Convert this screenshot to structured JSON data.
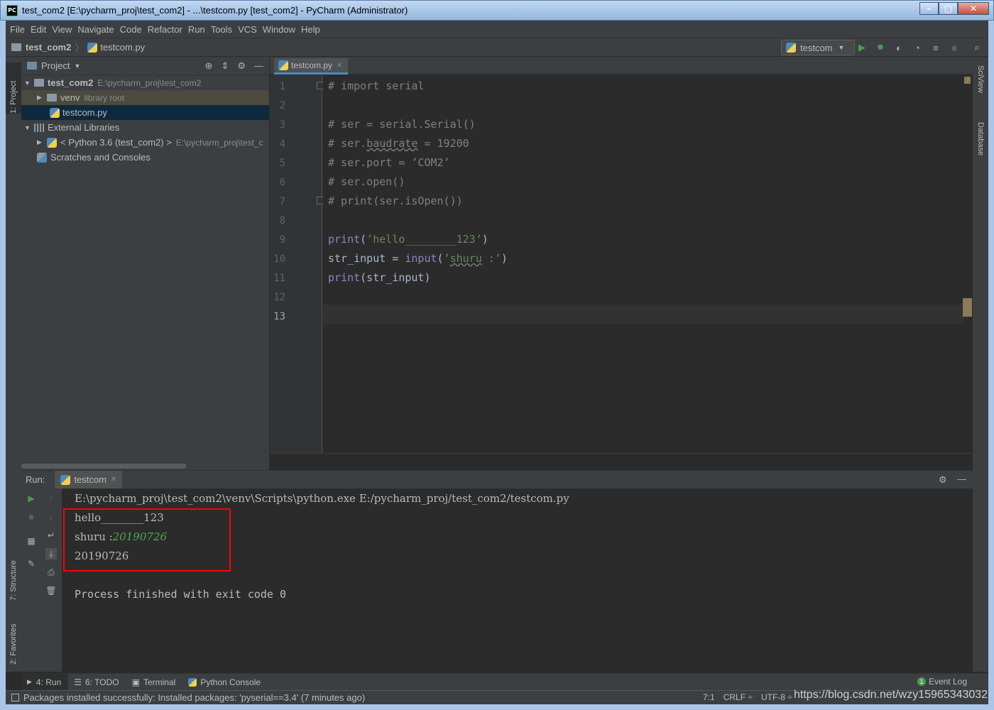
{
  "window": {
    "app_icon": "PC",
    "title": "test_com2 [E:\\pycharm_proj\\test_com2] - ...\\testcom.py [test_com2] - PyCharm (Administrator)",
    "buttons": {
      "minimize": "–",
      "maximize": "□",
      "close": "✕"
    }
  },
  "menu": [
    "File",
    "Edit",
    "View",
    "Navigate",
    "Code",
    "Refactor",
    "Run",
    "Tools",
    "VCS",
    "Window",
    "Help"
  ],
  "navbar": {
    "project": "test_com2",
    "separator": "〉",
    "file": "testcom.py",
    "run_config": "testcom",
    "run_config_arrow": "▼"
  },
  "left_strip": {
    "project_tab": "1: Project",
    "structure_tab": "7: Structure",
    "favorites_tab": "2: Favorites"
  },
  "right_strip": {
    "sciview": "SciView",
    "database": "Database"
  },
  "project_panel": {
    "title": "Project",
    "tree": {
      "root_name": "test_com2",
      "root_path": "E:\\pycharm_proj\\test_com2",
      "venv": "venv",
      "venv_note": "library root",
      "file": "testcom.py",
      "ext_libs": "External Libraries",
      "python": "< Python 3.6 (test_com2) >",
      "python_path": "E:\\pycharm_proj\\test_c",
      "scratches": "Scratches and Consoles"
    }
  },
  "editor": {
    "tab": "testcom.py",
    "line_numbers": [
      "1",
      "2",
      "3",
      "4",
      "5",
      "6",
      "7",
      "8",
      "9",
      "10",
      "11",
      "12",
      "13"
    ],
    "code": {
      "l1": "# import serial",
      "l3": "# ser = serial.Serial()",
      "l4_prefix": "# ser.",
      "l4_attr": "baudrate",
      "l4_suffix": " = 19200",
      "l5": "# ser.port = ’COM2’",
      "l6": "# ser.open()",
      "l7": "# print(ser.isOpen())",
      "l9_func": "print",
      "l9_open": "(",
      "l9_str": "’hello________123’",
      "l9_close": ")",
      "l10_var": "str_input = ",
      "l10_func": "input",
      "l10_open": "(",
      "l10_str_q": "’",
      "l10_str_word": "shuru",
      "l10_str_rest": " :’",
      "l10_close": ")",
      "l11_func": "print",
      "l11_rest": "(str_input)"
    }
  },
  "run_panel": {
    "label": "Run:",
    "tab": "testcom",
    "console": {
      "cmd": "E:\\pycharm_proj\\test_com2\\venv\\Scripts\\python.exe E:/pycharm_proj/test_com2/testcom.py",
      "out1": "hello________123",
      "prompt": "shuru :",
      "input_echo": "20190726",
      "out3": "20190726",
      "finished": "Process finished with exit code 0"
    }
  },
  "tool_tabs": {
    "run": "4: Run",
    "todo": "6: TODO",
    "terminal": "Terminal",
    "python_console": "Python Console",
    "event_log": "Event Log",
    "event_count": "1"
  },
  "status": {
    "message": "Packages installed successfully: Installed packages: 'pyserial==3.4' (7 minutes ago)",
    "position": "7:1",
    "line_sep": "CRLF ÷",
    "encoding": "UTF-8 ÷",
    "watermark": "https://blog.csdn.net/wzy15965343032"
  },
  "colors": {
    "background": "#2b2b2b",
    "panel": "#3c3f41",
    "comment": "#808080",
    "keyword": "#8888c6",
    "string": "#6a8759",
    "highlight_box": "#ff0000"
  }
}
